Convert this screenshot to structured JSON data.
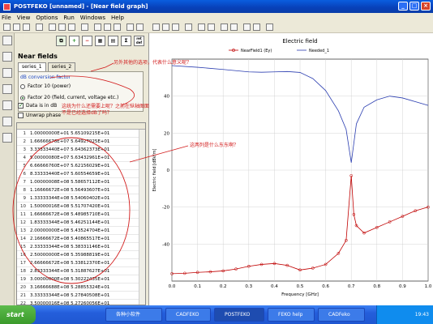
{
  "window": {
    "title": "POSTFEKO [unnamed] - [Near field graph]"
  },
  "menu": [
    "File",
    "View",
    "Options",
    "Run",
    "Windows",
    "Help"
  ],
  "panel": {
    "title": "Near fields",
    "tabs": [
      "series_1",
      "series_2"
    ],
    "group_label": "dB conversion factor",
    "radio1": "Factor 10 (power)",
    "radio2": "Factor 20 (field, current, voltage etc.)",
    "check1": "Data is in dB",
    "check2": "Unwrap phase",
    "calc_btn": "ret def"
  },
  "data_rows": [
    {
      "i": "1",
      "v": "1.00000000E+01 5.65109215E+01"
    },
    {
      "i": "2",
      "v": "1.66666676E+07 5.64927025E+01"
    },
    {
      "i": "3",
      "v": "3.33333440E+07 5.64362373E+01"
    },
    {
      "i": "4",
      "v": "5.00000080E+07 5.63432961E+01"
    },
    {
      "i": "5",
      "v": "6.66666760E+07 5.62156029E+01"
    },
    {
      "i": "6",
      "v": "8.33333440E+07 5.60554659E+01"
    },
    {
      "i": "7",
      "v": "1.00000008E+08 5.58657112E+01"
    },
    {
      "i": "8",
      "v": "1.16666672E+08 5.56493607E+01"
    },
    {
      "i": "9",
      "v": "1.33333344E+08 5.54060402E+01"
    },
    {
      "i": "10",
      "v": "1.50000016E+08 5.51707420E+01"
    },
    {
      "i": "11",
      "v": "1.66666672E+08 5.48985710E+01"
    },
    {
      "i": "12",
      "v": "1.83333344E+08 5.46251144E+01"
    },
    {
      "i": "13",
      "v": "2.00000000E+08 5.43524704E+01"
    },
    {
      "i": "14",
      "v": "2.16666672E+08 5.40865517E+01"
    },
    {
      "i": "15",
      "v": "2.33333344E+08 5.38331146E+01"
    },
    {
      "i": "16",
      "v": "2.50000000E+08 5.35988819E+01"
    },
    {
      "i": "17",
      "v": "2.66666672E+08 5.33812370E+01"
    },
    {
      "i": "18",
      "v": "2.83333344E+08 5.31887627E+01"
    },
    {
      "i": "19",
      "v": "3.00000000E+08 5.30222435E+01"
    },
    {
      "i": "20",
      "v": "3.16666688E+08 5.28855324E+01"
    },
    {
      "i": "21",
      "v": "3.33333344E+08 5.27840508E+01"
    },
    {
      "i": "22",
      "v": "3.50000016E+08 5.27260056E+01"
    }
  ],
  "annotations": {
    "note1": "另外其他的选项，代表什么意义呢？",
    "note2": "这统为什么还需要上呢？之前在纵轴图面不是已经选择dB了吗？",
    "note3": "这两列是什么东东啊？"
  },
  "chart_data": {
    "type": "line",
    "title": "Electric field",
    "xlabel": "Frequency [GHz]",
    "ylabel": "Electric field [dBV/m]",
    "xlim": [
      0,
      1
    ],
    "ylim": [
      -60,
      60
    ],
    "x_ticks": [
      "0.0",
      "0.1",
      "0.2",
      "0.3",
      "0.4",
      "0.5",
      "0.6",
      "0.7",
      "0.8",
      "0.9",
      "1.0"
    ],
    "y_ticks": [
      "40",
      "20",
      "0",
      "-20",
      "-40"
    ],
    "legend": [
      "NearField1 (Ey)",
      "Needed_1"
    ],
    "series": [
      {
        "name": "NearField1 (Ey)",
        "color": "#c00000",
        "marker": "circle",
        "x": [
          0,
          0.05,
          0.1,
          0.15,
          0.2,
          0.25,
          0.3,
          0.35,
          0.4,
          0.45,
          0.5,
          0.55,
          0.6,
          0.65,
          0.68,
          0.7,
          0.71,
          0.72,
          0.75,
          0.8,
          0.85,
          0.9,
          0.95,
          1.0
        ],
        "y": [
          -56,
          -55.8,
          -55.3,
          -55,
          -54.5,
          -53.5,
          -52,
          -51,
          -50.5,
          -51.5,
          -54,
          -53,
          -51,
          -45,
          -38,
          -3,
          -24,
          -30,
          -34,
          -31,
          -28,
          -25,
          -22,
          -20
        ]
      },
      {
        "name": "Needed_1",
        "color": "#2a3db0",
        "marker": "none",
        "x": [
          0,
          0.1,
          0.2,
          0.3,
          0.35,
          0.4,
          0.45,
          0.5,
          0.55,
          0.6,
          0.65,
          0.68,
          0.7,
          0.72,
          0.75,
          0.8,
          0.85,
          0.9,
          0.95,
          1.0
        ],
        "y": [
          56.5,
          55.6,
          54.4,
          53.1,
          52.9,
          53.1,
          53.3,
          52.8,
          49.5,
          43,
          32,
          22,
          4,
          25,
          34,
          38,
          40,
          39,
          37,
          35
        ]
      }
    ]
  },
  "taskbar": {
    "start": "start",
    "tasks": [
      "各种小软件",
      "CADFEKO",
      "POSTFEKO",
      "FEKO help",
      "CADFeko"
    ],
    "clock": "19:43"
  }
}
